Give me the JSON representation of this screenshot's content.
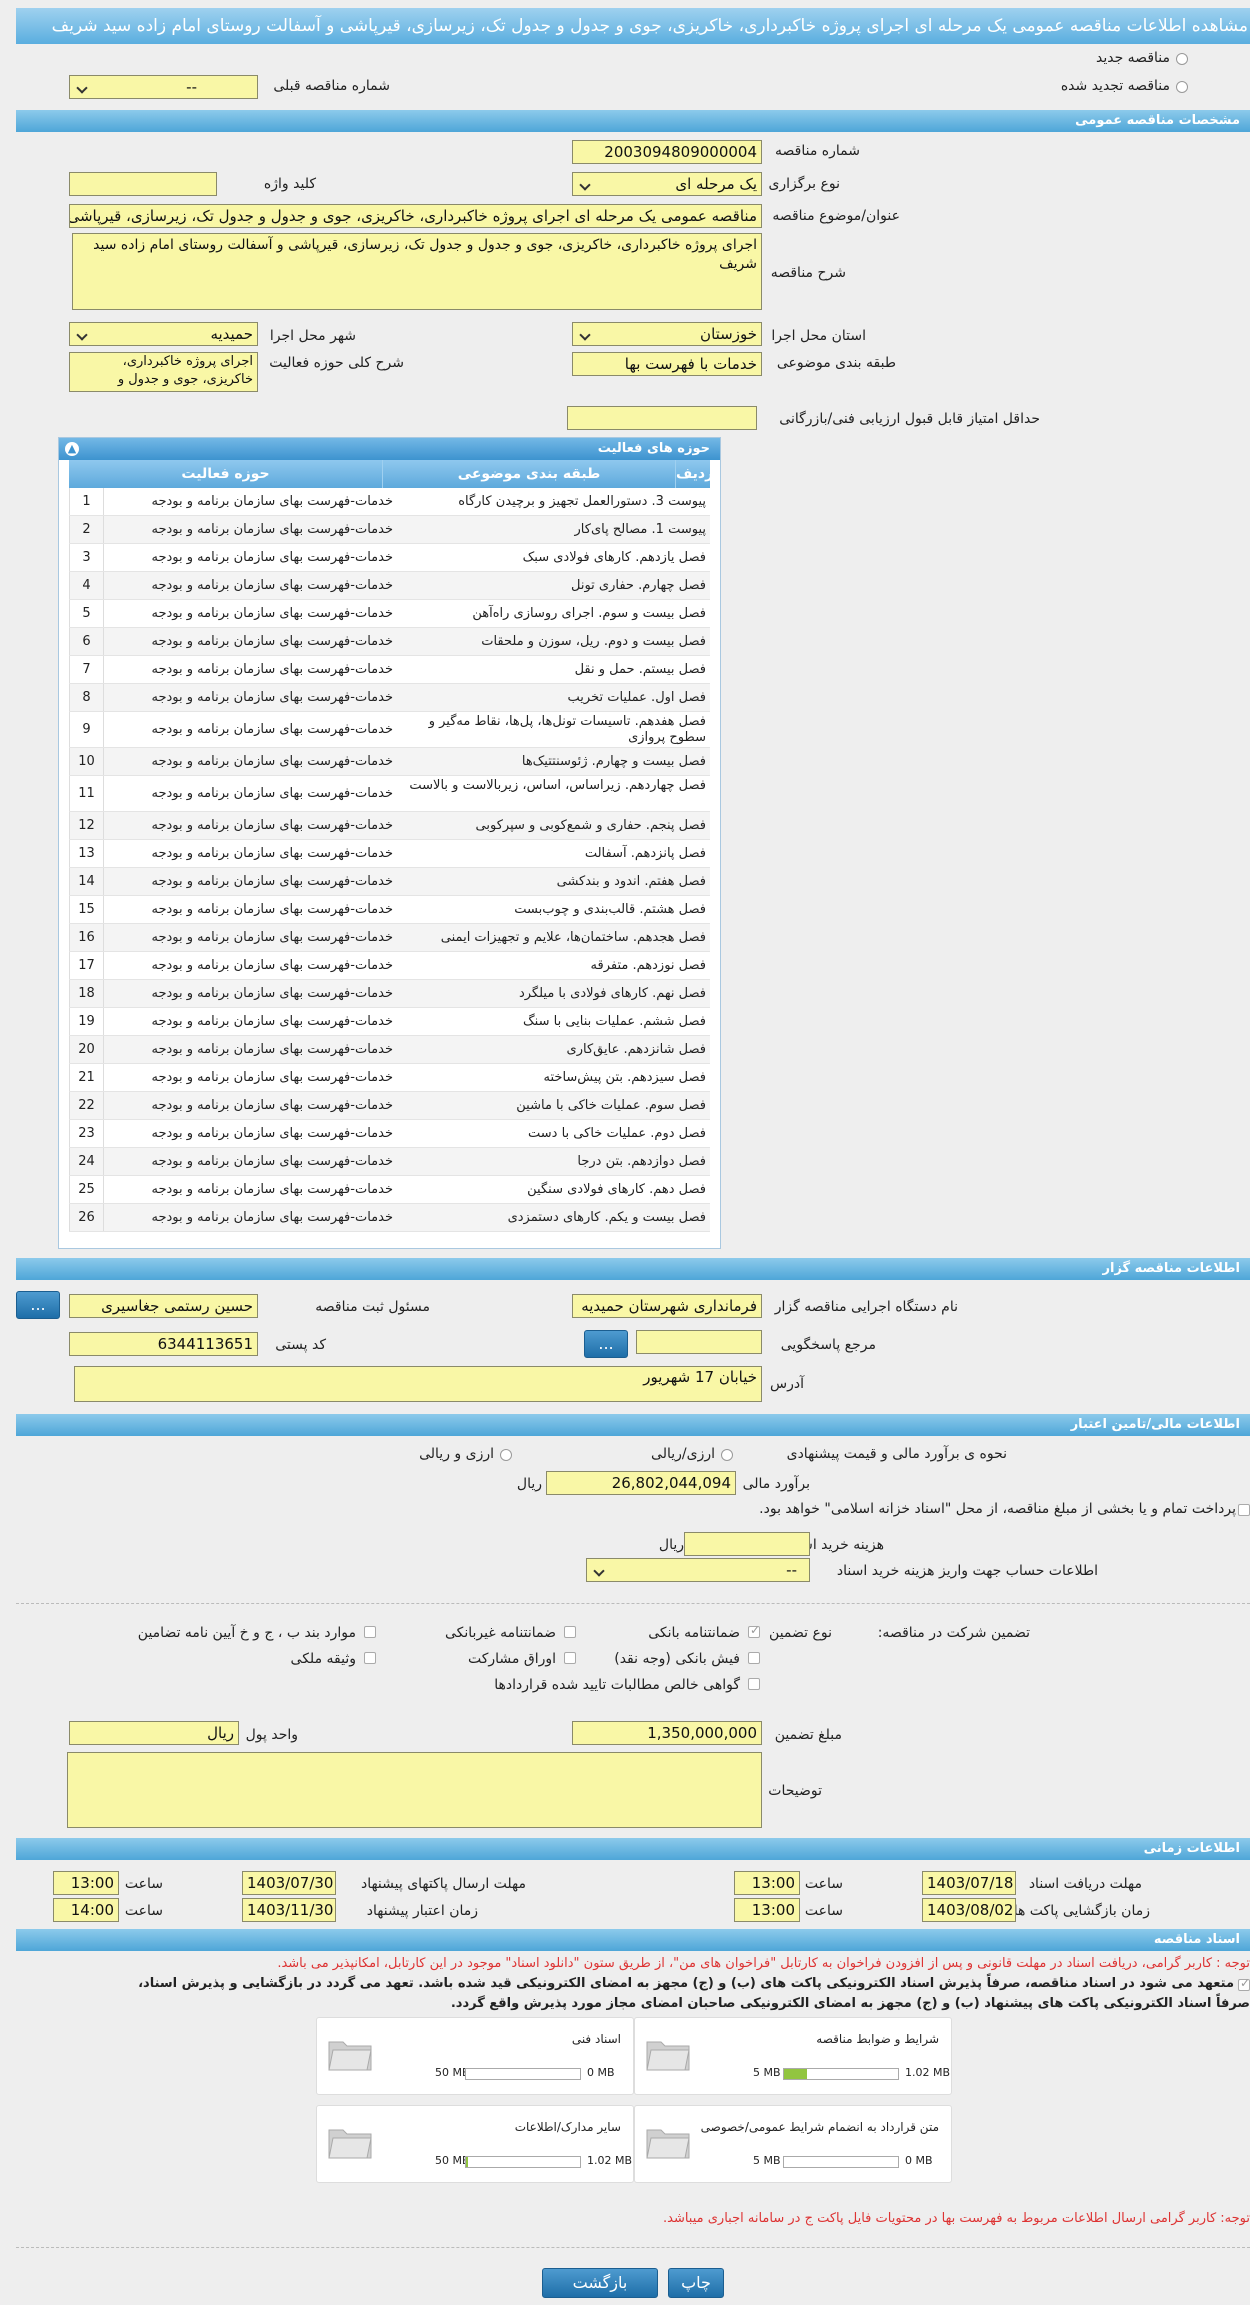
{
  "header": {
    "title": "مشاهده اطلاعات مناقصه عمومی یک مرحله ای اجرای پروژه خاکبرداری، خاکریزی، جوی و جدول و جدول تک، زیرسازی، قیرپاشی و آسفالت روستای امام زاده سید شریف"
  },
  "tender_type": {
    "new_label": "مناقصه جدید",
    "renewed_label": "مناقصه تجدید شده",
    "prev_number_label": "شماره مناقصه قبلی",
    "prev_number_value": "--"
  },
  "general": {
    "section_title": "مشخصات مناقصه عمومی",
    "number_label": "شماره مناقصه",
    "number_value": "2003094809000004",
    "type_label": "نوع برگزاری",
    "type_value": "یک مرحله ای",
    "keyword_label": "کلید واژه",
    "keyword_value": "",
    "subject_label": "عنوان/موضوع مناقصه",
    "subject_value": "مناقصه عمومی یک مرحله ای اجرای پروژه خاکبرداری، خاکریزی، جوی و جدول و جدول تک، زیرسازی، قیرپاشی و آسفالت روستای امام زاده سید شریف",
    "desc_label": "شرح مناقصه",
    "desc_value": "اجرای پروژه خاکبرداری، خاکریزی، جوی و جدول و جدول تک، زیرسازی، قیرپاشی و آسفالت روستای امام زاده سید شریف",
    "province_label": "استان محل اجرا",
    "province_value": "خوزستان",
    "city_label": "شهر محل اجرا",
    "city_value": "حمیدیه",
    "category_label": "طبقه بندی موضوعی",
    "category_value": "خدمات با فهرست بها",
    "scope_label": "شرح کلی حوزه فعالیت",
    "scope_value": "اجرای پروژه خاکبرداری، خاکریزی، جوی و جدول و",
    "min_score_label": "حداقل امتیاز قابل قبول ارزیابی فنی/بازرگانی",
    "min_score_value": ""
  },
  "activity": {
    "title": "حوزه های فعالیت",
    "col_row": "ردیف",
    "col_category": "طبقه بندی موضوعی",
    "col_field": "حوزه فعالیت",
    "rows": [
      {
        "n": "1",
        "cat": "خدمات-فهرست بهای سازمان برنامه و بودجه",
        "field": "پیوست 3. دستورالعمل تجهیز و برچیدن کارگاه"
      },
      {
        "n": "2",
        "cat": "خدمات-فهرست بهای سازمان برنامه و بودجه",
        "field": "پیوست 1. مصالح پای‌کار"
      },
      {
        "n": "3",
        "cat": "خدمات-فهرست بهای سازمان برنامه و بودجه",
        "field": "فصل یازدهم. کارهای فولادی سبک"
      },
      {
        "n": "4",
        "cat": "خدمات-فهرست بهای سازمان برنامه و بودجه",
        "field": "فصل چهارم. حفاری تونل"
      },
      {
        "n": "5",
        "cat": "خدمات-فهرست بهای سازمان برنامه و بودجه",
        "field": "فصل بیست و سوم. اجرای روسازی راه‌آهن"
      },
      {
        "n": "6",
        "cat": "خدمات-فهرست بهای سازمان برنامه و بودجه",
        "field": "فصل بیست و دوم. ریل، سوزن و ملحقات"
      },
      {
        "n": "7",
        "cat": "خدمات-فهرست بهای سازمان برنامه و بودجه",
        "field": "فصل بیستم. حمل و نقل"
      },
      {
        "n": "8",
        "cat": "خدمات-فهرست بهای سازمان برنامه و بودجه",
        "field": "فصل اول. عملیات تخریب"
      },
      {
        "n": "9",
        "cat": "خدمات-فهرست بهای سازمان برنامه و بودجه",
        "field": "فصل هفدهم. تاسیسات تونل‌ها، پل‌ها، نقاط مه‌گیر و سطوح پروازی"
      },
      {
        "n": "10",
        "cat": "خدمات-فهرست بهای سازمان برنامه و بودجه",
        "field": "فصل بیست و چهارم. ژئوسنتتیک‌ها"
      },
      {
        "n": "11",
        "cat": "خدمات-فهرست بهای سازمان برنامه و بودجه",
        "field": "فصل چهاردهم. زیراساس، اساس، زیربالاست و بالاست"
      },
      {
        "n": "12",
        "cat": "خدمات-فهرست بهای سازمان برنامه و بودجه",
        "field": "فصل پنجم. حفاری و شمع‌کوبی و سپرکوبی"
      },
      {
        "n": "13",
        "cat": "خدمات-فهرست بهای سازمان برنامه و بودجه",
        "field": "فصل پانزدهم. آسفالت"
      },
      {
        "n": "14",
        "cat": "خدمات-فهرست بهای سازمان برنامه و بودجه",
        "field": "فصل هفتم. اندود و بندکشی"
      },
      {
        "n": "15",
        "cat": "خدمات-فهرست بهای سازمان برنامه و بودجه",
        "field": "فصل هشتم. قالب‌بندی و چوب‌بست"
      },
      {
        "n": "16",
        "cat": "خدمات-فهرست بهای سازمان برنامه و بودجه",
        "field": "فصل هجدهم. ساختمان‌ها، علایم و تجهیزات ایمنی"
      },
      {
        "n": "17",
        "cat": "خدمات-فهرست بهای سازمان برنامه و بودجه",
        "field": "فصل نوزدهم. متفرقه"
      },
      {
        "n": "18",
        "cat": "خدمات-فهرست بهای سازمان برنامه و بودجه",
        "field": "فصل نهم. کارهای فولادی با میلگرد"
      },
      {
        "n": "19",
        "cat": "خدمات-فهرست بهای سازمان برنامه و بودجه",
        "field": "فصل ششم. عملیات بنایی با سنگ"
      },
      {
        "n": "20",
        "cat": "خدمات-فهرست بهای سازمان برنامه و بودجه",
        "field": "فصل شانزدهم. عایق‌کاری"
      },
      {
        "n": "21",
        "cat": "خدمات-فهرست بهای سازمان برنامه و بودجه",
        "field": "فصل سیزدهم. بتن پیش‌ساخته"
      },
      {
        "n": "22",
        "cat": "خدمات-فهرست بهای سازمان برنامه و بودجه",
        "field": "فصل سوم. عملیات خاکی با ماشین"
      },
      {
        "n": "23",
        "cat": "خدمات-فهرست بهای سازمان برنامه و بودجه",
        "field": "فصل دوم. عملیات خاکی با دست"
      },
      {
        "n": "24",
        "cat": "خدمات-فهرست بهای سازمان برنامه و بودجه",
        "field": "فصل دوازدهم. بتن درجا"
      },
      {
        "n": "25",
        "cat": "خدمات-فهرست بهای سازمان برنامه و بودجه",
        "field": "فصل دهم. کارهای فولادی سنگین"
      },
      {
        "n": "26",
        "cat": "خدمات-فهرست بهای سازمان برنامه و بودجه",
        "field": "فصل بیست و یکم. کارهای دستمزدی"
      }
    ]
  },
  "organizer": {
    "section_title": "اطلاعات مناقصه گزار",
    "org_label": "نام دستگاه اجرایی مناقصه گزار",
    "org_value": "فرمانداری شهرستان حمیدیه",
    "officer_label": "مسئول ثبت مناقصه",
    "officer_value": "حسین رستمی جغاسیری",
    "ref_label": "مرجع پاسخگویی",
    "ref_value": "",
    "postal_label": "کد پستی",
    "postal_value": "6344113651",
    "address_label": "آدرس",
    "address_value": "خیابان 17 شهریور",
    "dots": "..."
  },
  "finance": {
    "section_title": "اطلاعات مالی/تامین اعتبار",
    "method_label": "نحوه ی برآورد مالی و قیمت پیشنهادی",
    "rial_label": "ارزی/ریالی",
    "currency_label": "ارزی و ریالی",
    "estimate_label": "برآورد مالی",
    "estimate_value": "26,802,044,094",
    "rial_unit": "ریال",
    "treasury_text": "پرداخت تمام و یا بخشی از مبلغ مناقصه، از محل \"اسناد خزانه اسلامی\" خواهد بود.",
    "doc_cost_label": "هزینه خرید اسناد",
    "doc_cost_value": "",
    "doc_cost_unit": "ریال",
    "account_label": "اطلاعات حساب جهت واریز هزینه خرید اسناد",
    "account_value": "--"
  },
  "guarantee": {
    "title_label": "تضمین شرکت در مناقصه:",
    "type_label": "نوع تضمین",
    "opt_bank": "ضمانتنامه بانکی",
    "opt_nonbank": "ضمانتنامه غیربانکی",
    "opt_articles": "موارد بند ب ، ج و خ آیین نامه تضامین",
    "opt_check": "فیش بانکی (وجه نقد)",
    "opt_bonds": "اوراق مشارکت",
    "opt_property": "وثیقه ملکی",
    "opt_claims": "گواهی خالص مطالبات تایید شده قراردادها",
    "amount_label": "مبلغ تضمین",
    "amount_value": "1,350,000,000",
    "currency_label": "واحد پول",
    "currency_value": "ریال",
    "notes_label": "توضیحات",
    "notes_value": ""
  },
  "timing": {
    "section_title": "اطلاعات زمانی",
    "receive_label": "مهلت دریافت اسناد",
    "receive_date": "1403/07/18",
    "receive_time": "13:00",
    "send_label": "مهلت ارسال پاکتهای پیشنهاد",
    "send_date": "1403/07/30",
    "send_time": "13:00",
    "open_label": "زمان بازگشایی پاکت ها",
    "open_date": "1403/08/02",
    "open_time": "13:00",
    "valid_label": "زمان اعتبار پیشنهاد",
    "valid_date": "1403/11/30",
    "valid_time": "14:00",
    "time_label": "ساعت"
  },
  "documents": {
    "section_title": "اسناد مناقصه",
    "note1": "توجه : کاربر گرامی، دریافت اسناد در مهلت قانونی و پس از افزودن فراخوان به کارتابل \"فراخوان های من\"، از طریق ستون \"دانلود اسناد\" موجود در این کارتابل، امکانپذیر می باشد.",
    "commit1": "متعهد می شود در اسناد مناقصه، صرفاً پذیرش اسناد الکترونیکی پاکت های (ب) و (ج) مجهز به امضای الکترونیکی قید شده باشد. تعهد می گردد در بازگشایی و پذیرش اسناد،",
    "commit2": "صرفاً اسناد الکترونیکی پاکت های پیشنهاد (ب) و (ج) مجهز به امضای الکترونیکی صاحبان امضای مجاز مورد پذیرش واقع گردد.",
    "cards": [
      {
        "title": "شرایط و ضوابط مناقصه",
        "current": "1.02 MB",
        "max": "5 MB",
        "fill": 0.2
      },
      {
        "title": "اسناد فنی",
        "current": "0 MB",
        "max": "50 MB",
        "fill": 0
      },
      {
        "title": "متن قرارداد به انضمام شرایط عمومی/خصوصی",
        "current": "0 MB",
        "max": "5 MB",
        "fill": 0
      },
      {
        "title": "سایر مدارک/اطلاعات",
        "current": "1.02 MB",
        "max": "50 MB",
        "fill": 0.02
      }
    ],
    "note2": "توجه: کاربر گرامی ارسال اطلاعات مربوط به فهرست بها در محتویات فایل پاکت ج در سامانه اجباری میباشد."
  },
  "actions": {
    "back": "بازگشت",
    "print": "چاپ"
  },
  "colors": {
    "bar": "#4ea6d8",
    "field": "#f9f7a6",
    "progress": "#92c540",
    "note": "#dd3333"
  }
}
